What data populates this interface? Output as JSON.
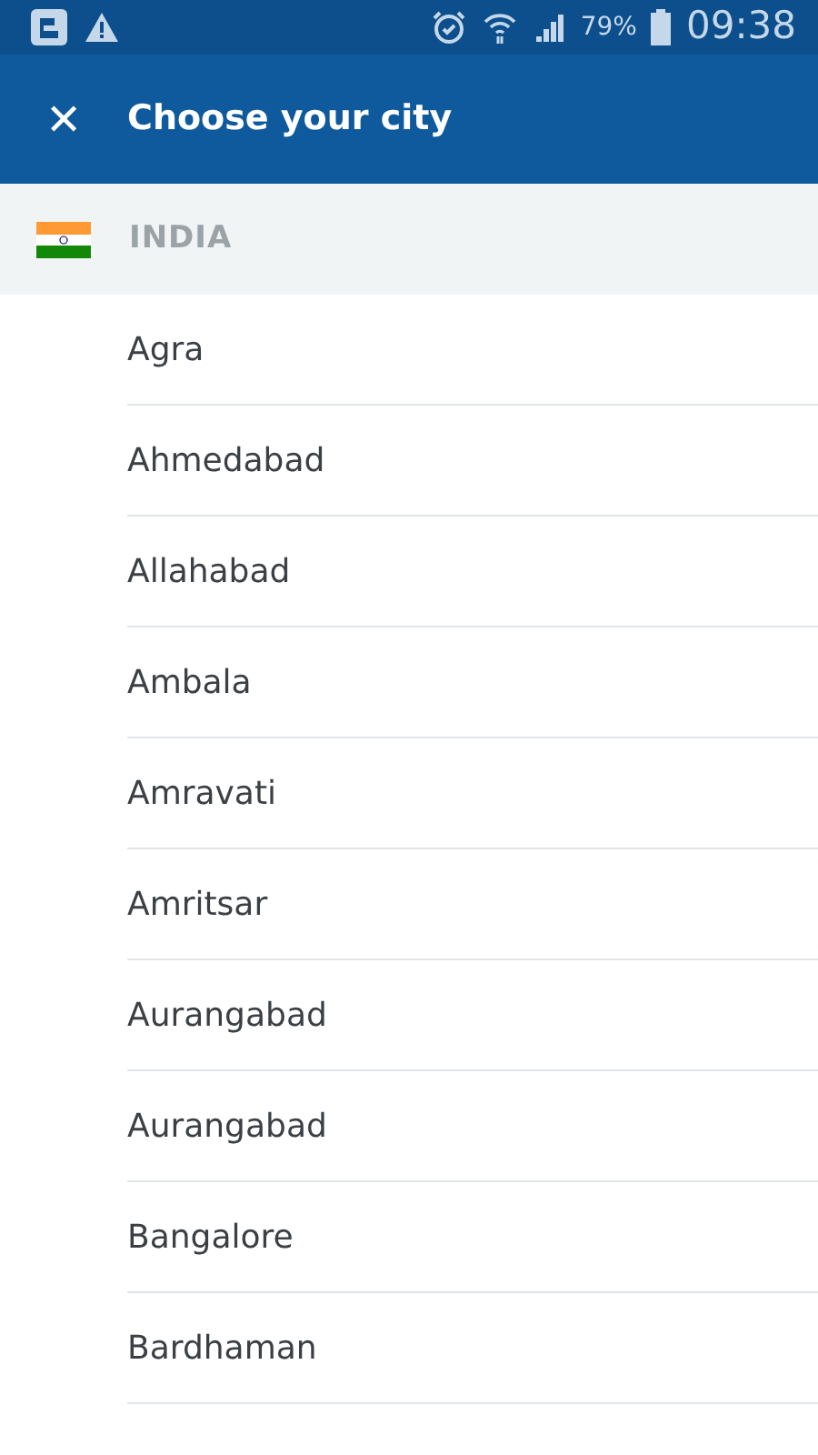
{
  "status_bar": {
    "battery": "79%",
    "time": "09:38"
  },
  "header": {
    "close": "✕",
    "title": "Choose your city"
  },
  "section": {
    "title": "INDIA"
  },
  "cities": [
    "Agra",
    "Ahmedabad",
    "Allahabad",
    "Ambala",
    "Amravati",
    "Amritsar",
    "Aurangabad",
    "Aurangabad",
    "Bangalore",
    "Bardhaman"
  ]
}
